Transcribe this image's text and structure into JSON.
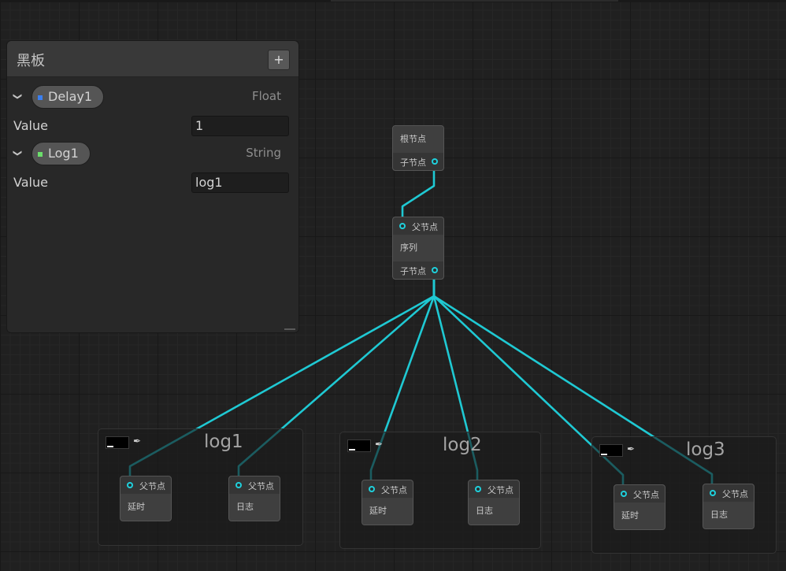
{
  "blackboard": {
    "title": "黑板",
    "add_label": "+",
    "variables": [
      {
        "name": "Delay1",
        "type": "Float",
        "value_label": "Value",
        "value": "1",
        "color": "#3a7ff0"
      },
      {
        "name": "Log1",
        "type": "String",
        "value_label": "Value",
        "value": "log1",
        "color": "#6bdd6b"
      }
    ]
  },
  "nodes": {
    "root": {
      "title": "根节点",
      "child_port": "子节点"
    },
    "sequence": {
      "parent_port": "父节点",
      "title": "序列",
      "child_port": "子节点"
    },
    "g1_delay": {
      "parent_port": "父节点",
      "title": "延时"
    },
    "g1_log": {
      "parent_port": "父节点",
      "title": "日志"
    },
    "g2_delay": {
      "parent_port": "父节点",
      "title": "延时"
    },
    "g2_log": {
      "parent_port": "父节点",
      "title": "日志"
    },
    "g3_delay": {
      "parent_port": "父节点",
      "title": "延时"
    },
    "g3_log": {
      "parent_port": "父节点",
      "title": "日志"
    }
  },
  "groups": [
    {
      "title": "log1",
      "swatch_color": "#000000"
    },
    {
      "title": "log2",
      "swatch_color": "#000000"
    },
    {
      "title": "log3",
      "swatch_color": "#000000"
    }
  ],
  "connection_color": "#1fc9d3",
  "port_color": "#1fd0dc",
  "icons": {
    "collapse": "chevron-down-icon",
    "color_picker": "eyedropper-icon",
    "port": "port-circle-icon"
  }
}
